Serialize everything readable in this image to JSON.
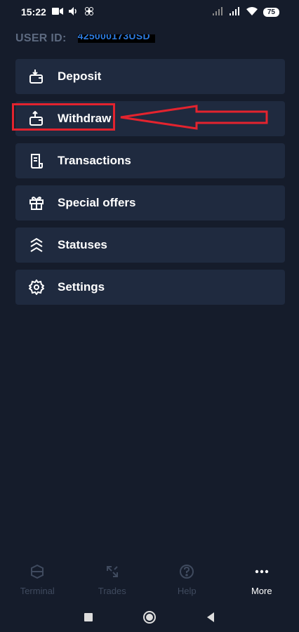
{
  "status_bar": {
    "time": "15:22",
    "battery": "75"
  },
  "user_id": {
    "label": "USER ID:",
    "value": "425000173USD"
  },
  "menu": {
    "items": [
      {
        "label": "Deposit",
        "icon": "wallet-in-icon"
      },
      {
        "label": "Withdraw",
        "icon": "wallet-out-icon"
      },
      {
        "label": "Transactions",
        "icon": "receipt-icon"
      },
      {
        "label": "Special offers",
        "icon": "gift-icon"
      },
      {
        "label": "Statuses",
        "icon": "chevrons-up-icon"
      },
      {
        "label": "Settings",
        "icon": "gear-icon"
      }
    ]
  },
  "bottom_nav": {
    "items": [
      {
        "label": "Terminal",
        "icon": "terminal-icon",
        "active": false
      },
      {
        "label": "Trades",
        "icon": "arrows-icon",
        "active": false
      },
      {
        "label": "Help",
        "icon": "help-icon",
        "active": false
      },
      {
        "label": "More",
        "icon": "more-icon",
        "active": true
      }
    ]
  },
  "colors": {
    "background": "#151c2b",
    "card": "#1f2a3f",
    "highlight": "#e3232e",
    "muted": "#3f4a5e"
  }
}
